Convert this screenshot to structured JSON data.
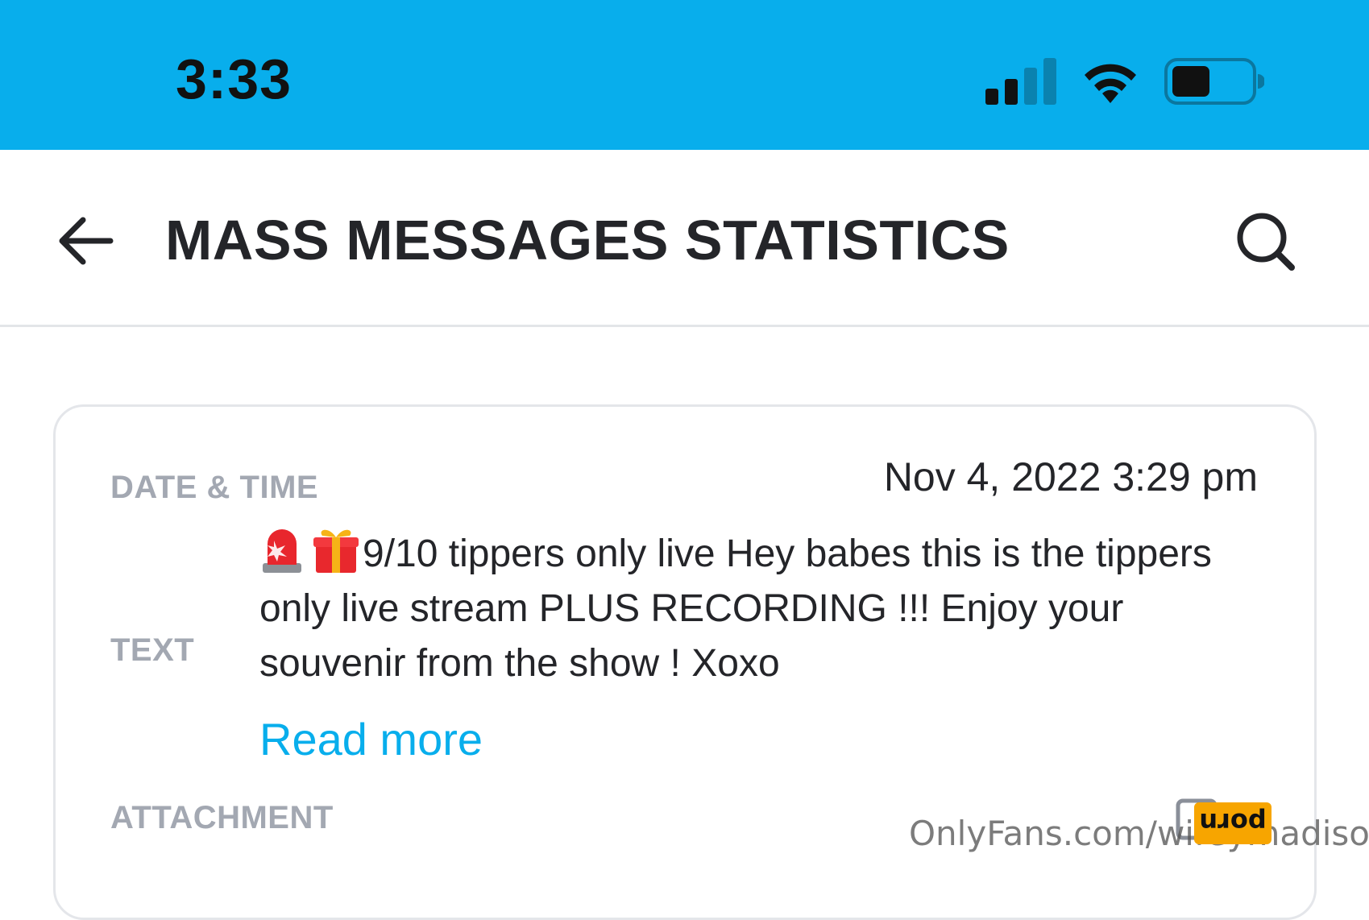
{
  "status_bar": {
    "time": "3:33",
    "icons": [
      "signal-icon",
      "wifi-icon",
      "battery-icon"
    ]
  },
  "header": {
    "title": "MASS MESSAGES STATISTICS",
    "back_icon": "back-arrow-icon",
    "search_icon": "search-icon"
  },
  "card": {
    "date_label": "DATE & TIME",
    "date_value": "Nov 4, 2022 3:29 pm",
    "text_label": "TEXT",
    "message_emojis": [
      "siren-emoji",
      "gift-emoji"
    ],
    "message_text": "9/10 tippers only live Hey babes this is the tippers only live stream PLUS RECORDING !!! Enjoy your souvenir from the show ! Xoxo",
    "read_more": "Read more",
    "attachment_label": "ATTACHMENT",
    "attachment_icon": "image-icon"
  },
  "watermark": {
    "text": "OnlyFans.com/wifeymadison",
    "badge": "porn"
  },
  "colors": {
    "status_bar": "#08aeec",
    "accent": "#08aeec",
    "title": "#242529",
    "label": "#a3a8b2",
    "border": "#e4e6ea"
  }
}
